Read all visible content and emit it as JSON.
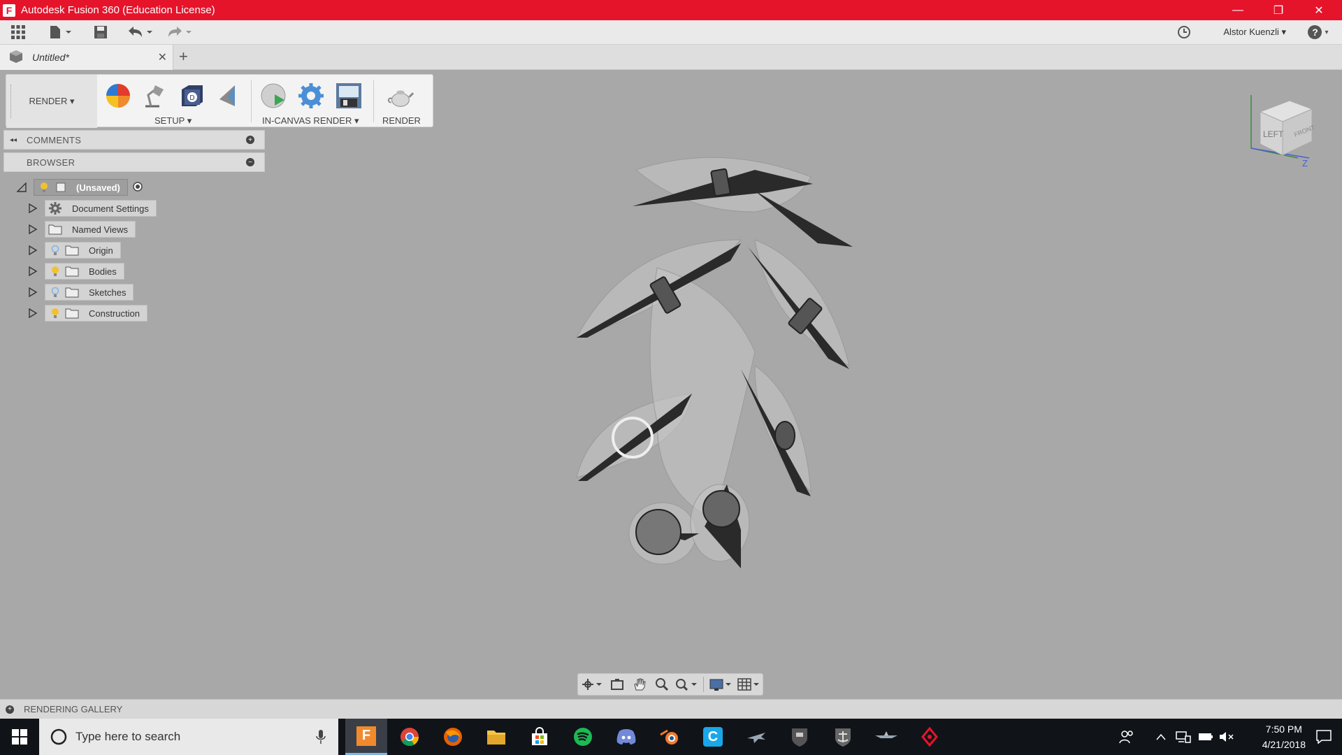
{
  "window": {
    "title": "Autodesk Fusion 360 (Education License)",
    "app_letter": "F",
    "controls": {
      "minimize": "—",
      "restore": "❐",
      "close": "✕"
    }
  },
  "toolbar": {
    "user": "Alstor Kuenzli ▾",
    "help": "?"
  },
  "tabs": {
    "doc_title": "Untitled*",
    "close": "✕",
    "new_tab": "+"
  },
  "ribbon": {
    "workspace": "RENDER ▾",
    "setup_label": "SETUP ▾",
    "incanvas_label": "IN-CANVAS RENDER ▾",
    "render_label": "RENDER"
  },
  "panels": {
    "comments": "COMMENTS",
    "browser": "BROWSER"
  },
  "browser": {
    "root": "(Unsaved)",
    "items": [
      {
        "label": "Document Settings",
        "icon": "gear-icon"
      },
      {
        "label": "Named Views",
        "icon": "folder-icon"
      },
      {
        "label": "Origin",
        "icon": "folder-icon",
        "bulb": "off"
      },
      {
        "label": "Bodies",
        "icon": "folder-icon",
        "bulb": "on"
      },
      {
        "label": "Sketches",
        "icon": "folder-icon",
        "bulb": "off"
      },
      {
        "label": "Construction",
        "icon": "folder-icon",
        "bulb": "on"
      }
    ]
  },
  "viewcube": {
    "face_left": "LEFT",
    "face_front": "FRONT",
    "axis_z": "Z"
  },
  "gallery": {
    "label": "RENDERING GALLERY"
  },
  "taskbar": {
    "search_placeholder": "Type here to search",
    "time": "7:50 PM",
    "date": "4/21/2018"
  },
  "colors": {
    "titlebar": "#e5142b",
    "viewport_bg": "#a8a8a8",
    "taskbar": "#101419",
    "bulb_on": "#f2c12e",
    "bulb_off": "#7fb6e6"
  }
}
